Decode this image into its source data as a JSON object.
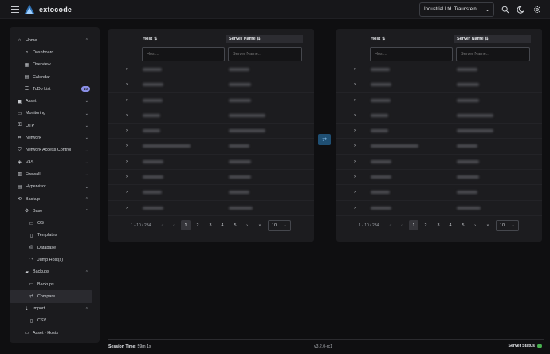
{
  "app": {
    "brand": "extocode"
  },
  "topbar": {
    "tenant_selected": "Industrial Ltd. Traunstein",
    "icons": [
      "search-icon",
      "moon-icon",
      "gear-icon"
    ]
  },
  "sidebar": {
    "items": [
      {
        "label": "Home",
        "icon": "home-icon",
        "level": 0,
        "chevron": "up"
      },
      {
        "label": "Dashboard",
        "icon": "dashboard-icon",
        "level": 1
      },
      {
        "label": "Overview",
        "icon": "grid-icon",
        "level": 1
      },
      {
        "label": "Calendar",
        "icon": "calendar-icon",
        "level": 1
      },
      {
        "label": "ToDo List",
        "icon": "list-icon",
        "level": 1,
        "badge": "10"
      },
      {
        "label": "Asset",
        "icon": "box-icon",
        "level": 0,
        "chevron": "down"
      },
      {
        "label": "Monitoring",
        "icon": "monitor-icon",
        "level": 0,
        "chevron": "down"
      },
      {
        "label": "OTP",
        "icon": "key-icon",
        "level": 0,
        "chevron": "down"
      },
      {
        "label": "Network",
        "icon": "network-icon",
        "level": 0,
        "chevron": "down"
      },
      {
        "label": "Network Access Control",
        "icon": "shield-icon",
        "level": 0,
        "chevron": "down"
      },
      {
        "label": "VAS",
        "icon": "vas-icon",
        "level": 0,
        "chevron": "down"
      },
      {
        "label": "Firewall",
        "icon": "firewall-icon",
        "level": 0,
        "chevron": "down"
      },
      {
        "label": "Hypervisor",
        "icon": "server-icon",
        "level": 0,
        "chevron": "down"
      },
      {
        "label": "Backup",
        "icon": "backup-icon",
        "level": 0,
        "chevron": "up"
      },
      {
        "label": "Base",
        "icon": "settings-icon",
        "level": 1,
        "chevron": "up"
      },
      {
        "label": "OS",
        "icon": "monitor-icon",
        "level": 2
      },
      {
        "label": "Templates",
        "icon": "file-icon",
        "level": 2
      },
      {
        "label": "Database",
        "icon": "database-icon",
        "level": 2
      },
      {
        "label": "Jump Host(s)",
        "icon": "jump-icon",
        "level": 2
      },
      {
        "label": "Backups",
        "icon": "folder-icon",
        "level": 1,
        "chevron": "up"
      },
      {
        "label": "Backups",
        "icon": "monitor-icon",
        "level": 2
      },
      {
        "label": "Compare",
        "icon": "compare-icon",
        "level": 2,
        "active": true
      },
      {
        "label": "Import",
        "icon": "import-icon",
        "level": 1,
        "chevron": "up"
      },
      {
        "label": "CSV",
        "icon": "file-icon",
        "level": 2
      },
      {
        "label": "Asset - Hosts",
        "icon": "host-icon",
        "level": 1
      }
    ]
  },
  "panels": [
    {
      "col_host": "Host ⇅",
      "col_name": "Server Name ⇅",
      "filter_host_placeholder": "Host...",
      "filter_name_placeholder": "Server Name...",
      "range": "1 - 10 / 234",
      "pages": [
        "«",
        "‹",
        "1",
        "2",
        "3",
        "4",
        "5",
        "›",
        "»"
      ],
      "per_page": "10"
    },
    {
      "col_host": "Host ⇅",
      "col_name": "Server Name ⇅",
      "filter_host_placeholder": "Host...",
      "filter_name_placeholder": "Server Name...",
      "range": "1 - 10 / 234",
      "pages": [
        "«",
        "‹",
        "1",
        "2",
        "3",
        "4",
        "5",
        "›",
        "»"
      ],
      "per_page": "10"
    }
  ],
  "compare_button_icon": "swap-icon",
  "footer": {
    "session_label": "Session Time:",
    "session_value": "59m 1s",
    "version": "v3.2.0-rc1",
    "status_label": "Server Status"
  },
  "colors": {
    "accent": "#8a8fe6",
    "status_ok": "#48b14f",
    "compare_bg": "#1f4f73"
  }
}
